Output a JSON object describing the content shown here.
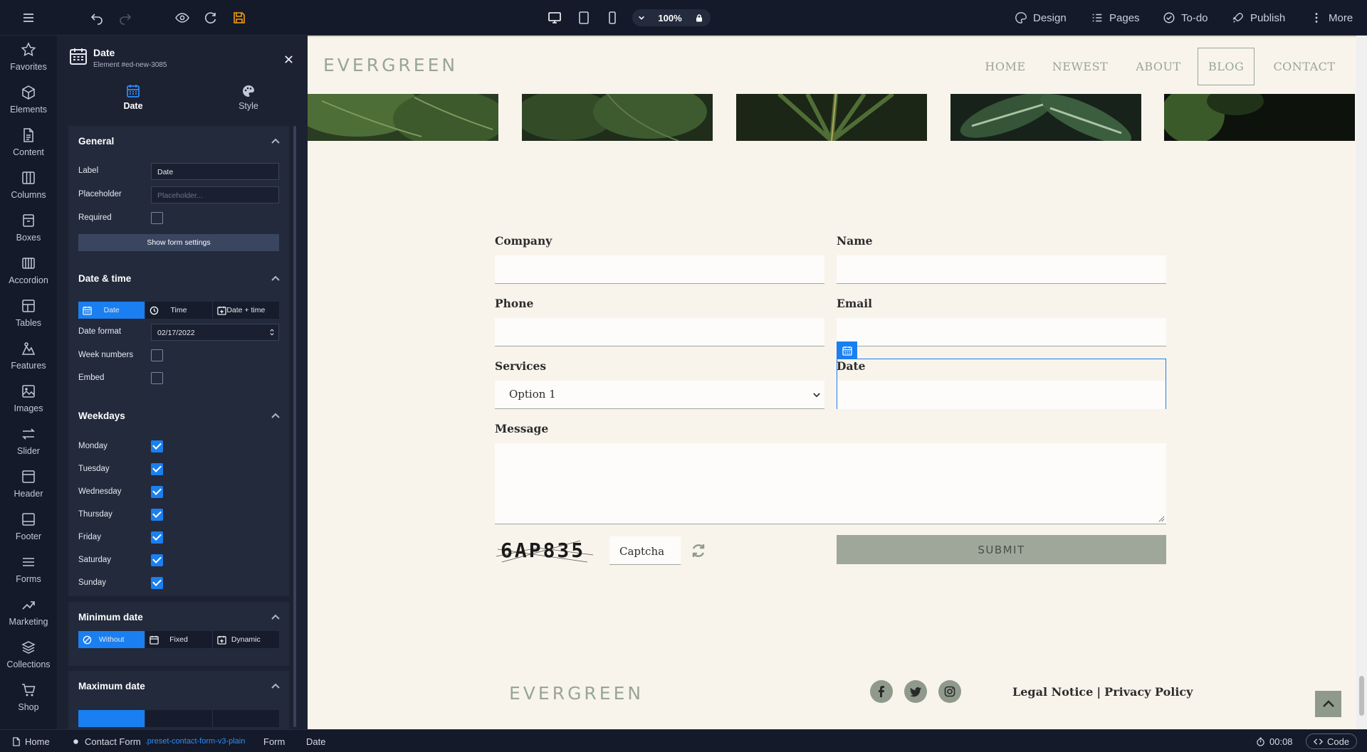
{
  "toolbar": {
    "zoom": "100%",
    "design": "Design",
    "pages": "Pages",
    "todo": "To-do",
    "publish": "Publish",
    "more": "More"
  },
  "rail": [
    "Favorites",
    "Elements",
    "Content",
    "Columns",
    "Boxes",
    "Accordion",
    "Tables",
    "Features",
    "Images",
    "Slider",
    "Header",
    "Footer",
    "Forms",
    "Marketing",
    "Collections",
    "Shop"
  ],
  "panel": {
    "title": "Date",
    "subtitle": "Element #ed-new-3085",
    "tab_date": "Date",
    "tab_style": "Style",
    "general": {
      "title": "General",
      "label_label": "Label",
      "label_value": "Date",
      "placeholder_label": "Placeholder",
      "placeholder_placeholder": "Placeholder...",
      "required_label": "Required",
      "show_form_settings": "Show form settings"
    },
    "datetime": {
      "title": "Date & time",
      "mode_date": "Date",
      "mode_time": "Time",
      "mode_datetime": "Date + time",
      "format_label": "Date format",
      "format_value": "02/17/2022",
      "week_numbers": "Week numbers",
      "embed": "Embed"
    },
    "weekdays": {
      "title": "Weekdays",
      "days": [
        "Monday",
        "Tuesday",
        "Wednesday",
        "Thursday",
        "Friday",
        "Saturday",
        "Sunday"
      ]
    },
    "min_date": {
      "title": "Minimum date",
      "without": "Without",
      "fixed": "Fixed",
      "dynamic": "Dynamic"
    },
    "max_date": {
      "title": "Maximum date"
    }
  },
  "site": {
    "logo": "EVERGREEN",
    "nav": [
      "HOME",
      "NEWEST",
      "ABOUT",
      "BLOG",
      "CONTACT"
    ],
    "form": {
      "company": "Company",
      "name": "Name",
      "phone": "Phone",
      "email": "Email",
      "services": "Services",
      "services_value": "Option 1",
      "date": "Date",
      "message": "Message",
      "captcha_code": "6AP835",
      "captcha_placeholder": "Captcha",
      "submit": "SUBMIT"
    },
    "footer": {
      "logo": "EVERGREEN",
      "legal": "Legal Notice",
      "separator": "|",
      "privacy": "Privacy Policy"
    }
  },
  "status": {
    "home": "Home",
    "contact_form": "Contact Form",
    "preset": ".preset-contact-form-v3-plain",
    "form": "Form",
    "date": "Date",
    "timer": "00:08",
    "code": "Code"
  },
  "colors": {
    "accent": "#1a7ff0",
    "site_bg": "#f8f4ec",
    "sage": "#99a597",
    "submit_bg": "#9ea79a"
  }
}
